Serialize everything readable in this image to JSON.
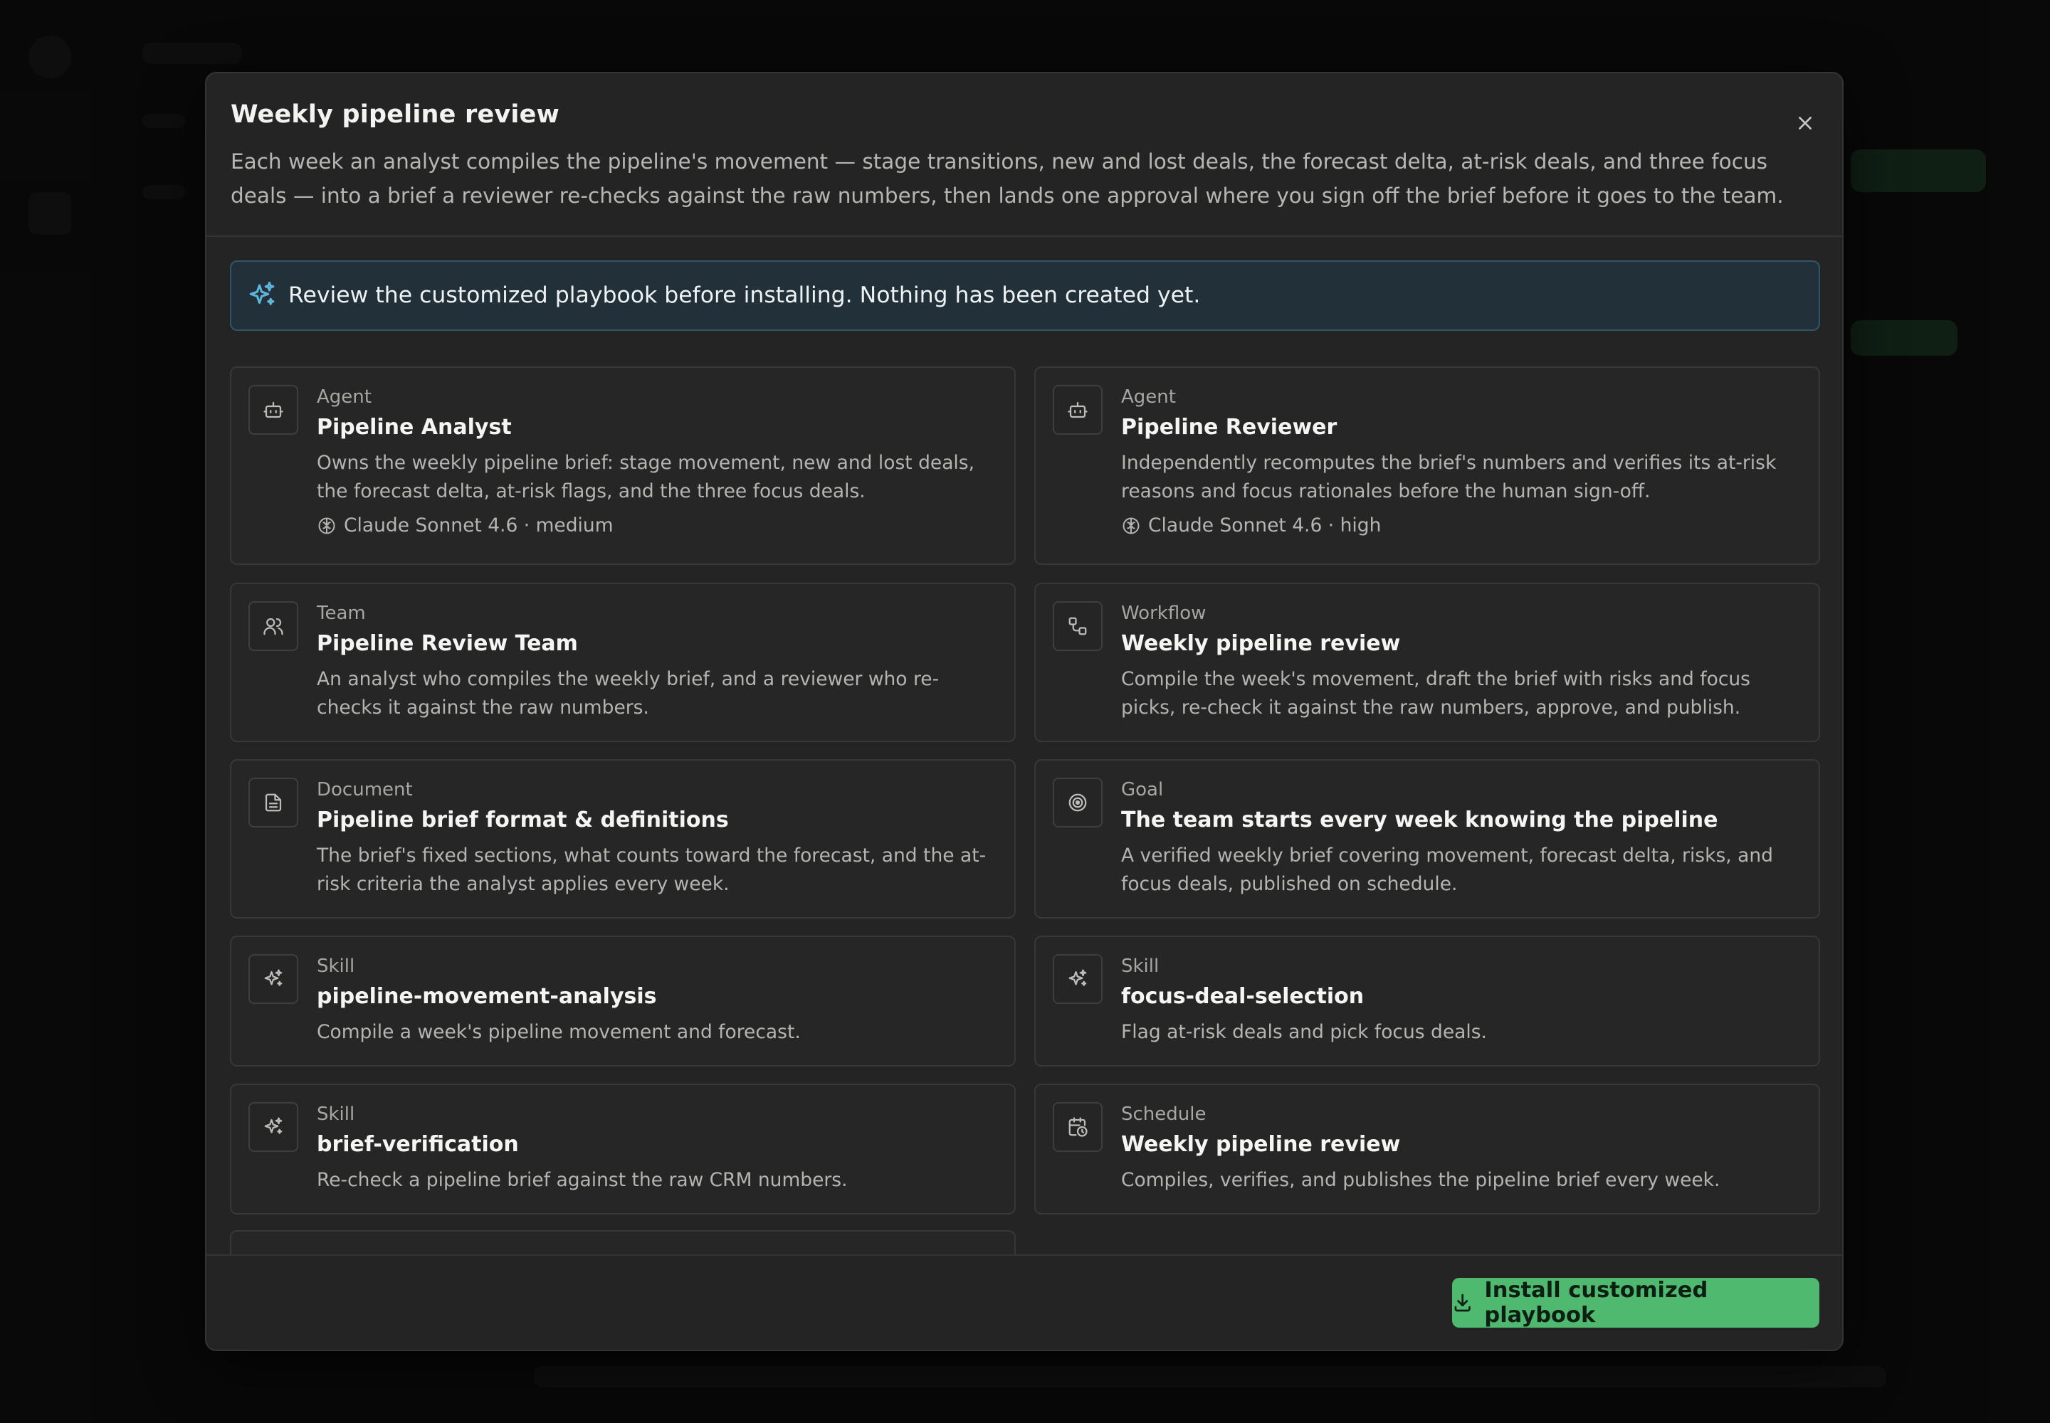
{
  "modal": {
    "title": "Weekly pipeline review",
    "description": "Each week an analyst compiles the pipeline's movement — stage transitions, new and lost deals, the forecast delta, at-risk deals, and three focus deals — into a brief a reviewer re-checks against the raw numbers, then lands one approval where you sign off the brief before it goes to the team.",
    "close_icon": "close-icon"
  },
  "notice": {
    "icon": "sparkle-icon",
    "text": "Review the customized playbook before installing. Nothing has been created yet."
  },
  "cards": [
    {
      "type": "Agent",
      "title": "Pipeline Analyst",
      "description": "Owns the weekly pipeline brief: stage movement, new and lost deals, the forecast delta, at-risk flags, and the three focus deals.",
      "meta": "Claude Sonnet 4.6 · medium",
      "icon": "bot-icon"
    },
    {
      "type": "Agent",
      "title": "Pipeline Reviewer",
      "description": "Independently recomputes the brief's numbers and verifies its at-risk reasons and focus rationales before the human sign-off.",
      "meta": "Claude Sonnet 4.6 · high",
      "icon": "bot-icon"
    },
    {
      "type": "Team",
      "title": "Pipeline Review Team",
      "description": "An analyst who compiles the weekly brief, and a reviewer who re-checks it against the raw numbers.",
      "icon": "users-icon"
    },
    {
      "type": "Workflow",
      "title": "Weekly pipeline review",
      "description": "Compile the week's movement, draft the brief with risks and focus picks, re-check it against the raw numbers, approve, and publish.",
      "icon": "workflow-icon"
    },
    {
      "type": "Document",
      "title": "Pipeline brief format & definitions",
      "description": "The brief's fixed sections, what counts toward the forecast, and the at-risk criteria the analyst applies every week.",
      "icon": "document-icon"
    },
    {
      "type": "Goal",
      "title": "The team starts every week knowing the pipeline",
      "description": "A verified weekly brief covering movement, forecast delta, risks, and focus deals, published on schedule.",
      "icon": "target-icon"
    },
    {
      "type": "Skill",
      "title": "pipeline-movement-analysis",
      "description": "Compile a week's pipeline movement and forecast.",
      "icon": "sparkle-icon"
    },
    {
      "type": "Skill",
      "title": "focus-deal-selection",
      "description": "Flag at-risk deals and pick focus deals.",
      "icon": "sparkle-icon"
    },
    {
      "type": "Skill",
      "title": "brief-verification",
      "description": "Re-check a pipeline brief against the raw CRM numbers.",
      "icon": "sparkle-icon"
    },
    {
      "type": "Schedule",
      "title": "Weekly pipeline review",
      "description": "Compiles, verifies, and publishes the pipeline brief every week.",
      "icon": "calendar-clock-icon"
    }
  ],
  "footer": {
    "install_label": "Install customized playbook",
    "install_icon": "download-icon"
  },
  "colors": {
    "accent_green": "#4fb96f",
    "notice_bg": "#223039",
    "modal_bg": "#242424"
  }
}
